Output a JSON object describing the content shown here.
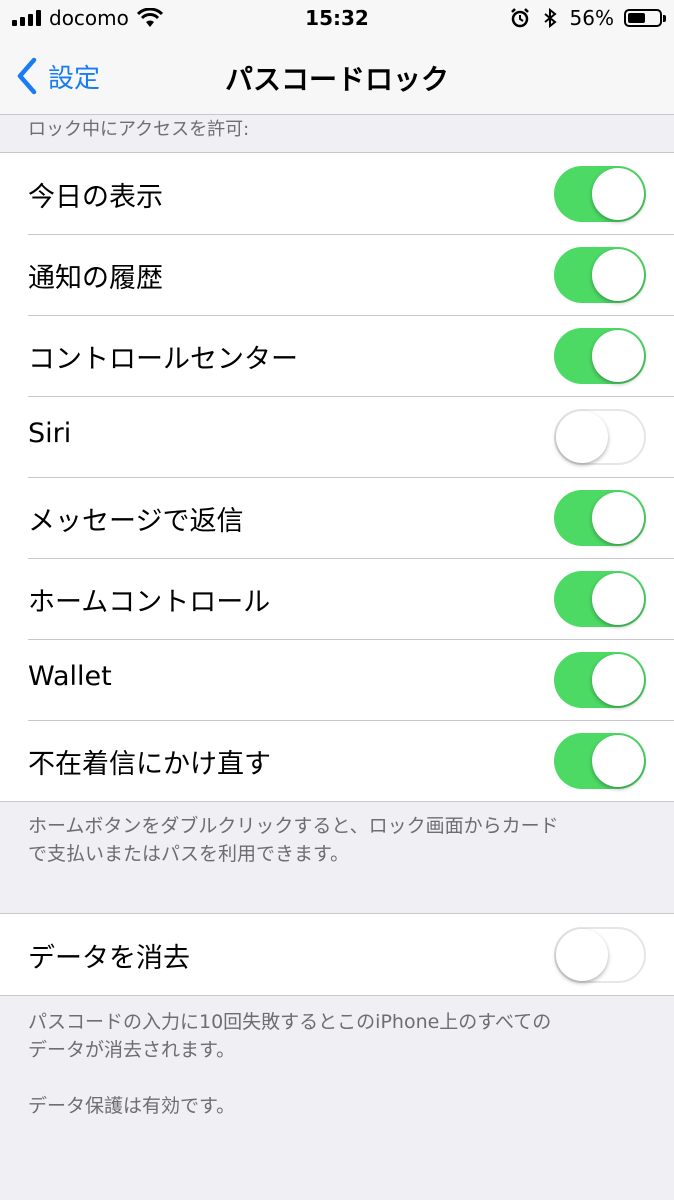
{
  "status_bar": {
    "carrier": "docomo",
    "time": "15:32",
    "battery_percent": "56%",
    "battery_level": 0.56,
    "icons": [
      "signal-icon",
      "wifi-icon",
      "alarm-icon",
      "bluetooth-icon",
      "battery-icon"
    ]
  },
  "nav": {
    "back_label": "設定",
    "title": "パスコードロック"
  },
  "lock_access": {
    "header": "ロック中にアクセスを許可:",
    "items": [
      {
        "label": "今日の表示",
        "on": true
      },
      {
        "label": "通知の履歴",
        "on": true
      },
      {
        "label": "コントロールセンター",
        "on": true
      },
      {
        "label": "Siri",
        "on": false
      },
      {
        "label": "メッセージで返信",
        "on": true
      },
      {
        "label": "ホームコントロール",
        "on": true
      },
      {
        "label": "Wallet",
        "on": true
      },
      {
        "label": "不在着信にかけ直す",
        "on": true
      }
    ],
    "footer_line1": "ホームボタンをダブルクリックすると、ロック画面からカード",
    "footer_line2": "で支払いまたはパスを利用できます。"
  },
  "erase": {
    "label": "データを消去",
    "on": false,
    "footer_line1": "パスコードの入力に10回失敗するとこのiPhone上のすべての",
    "footer_line2": "データが消去されます。",
    "footer_line3": "データ保護は有効です。"
  },
  "colors": {
    "accent": "#1a7cf5",
    "toggle_on": "#4cd964",
    "background": "#efeff4"
  }
}
